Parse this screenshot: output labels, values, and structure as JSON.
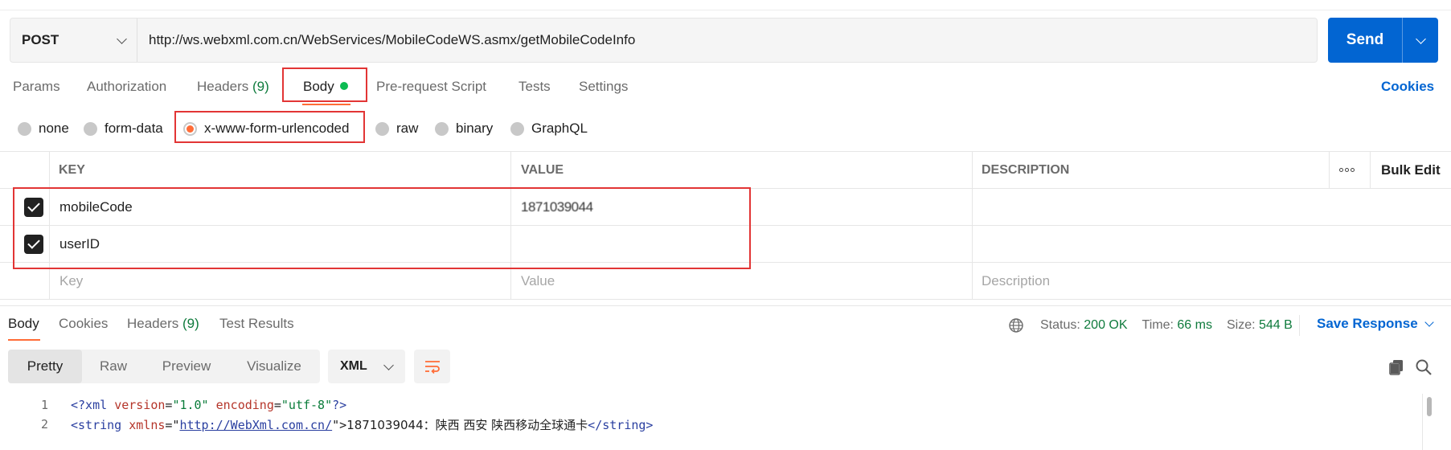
{
  "request": {
    "method": "POST",
    "url": "http://ws.webxml.com.cn/WebServices/MobileCodeWS.asmx/getMobileCodeInfo",
    "send_label": "Send"
  },
  "req_tabs": {
    "params": "Params",
    "authorization": "Authorization",
    "headers": "Headers",
    "headers_count": "(9)",
    "body": "Body",
    "pre_request": "Pre-request Script",
    "tests": "Tests",
    "settings": "Settings",
    "cookies": "Cookies"
  },
  "body_types": {
    "none": "none",
    "form_data": "form-data",
    "urlencoded": "x-www-form-urlencoded",
    "raw": "raw",
    "binary": "binary",
    "graphql": "GraphQL",
    "selected": "x-www-form-urlencoded"
  },
  "params_table": {
    "headers": {
      "key": "KEY",
      "value": "VALUE",
      "description": "DESCRIPTION",
      "bulk_edit": "Bulk Edit"
    },
    "rows": [
      {
        "key": "mobileCode",
        "value": "1871039044",
        "checked": true
      },
      {
        "key": "userID",
        "value": "",
        "checked": true
      }
    ],
    "placeholders": {
      "key": "Key",
      "value": "Value",
      "description": "Description"
    }
  },
  "response": {
    "tabs": {
      "body": "Body",
      "cookies": "Cookies",
      "headers": "Headers",
      "headers_count": "(9)",
      "test_results": "Test Results"
    },
    "status_label": "Status:",
    "status_value": "200 OK",
    "time_label": "Time:",
    "time_value": "66 ms",
    "size_label": "Size:",
    "size_value": "544 B",
    "save_label": "Save Response",
    "view_tabs": {
      "pretty": "Pretty",
      "raw": "Raw",
      "preview": "Preview",
      "visualize": "Visualize"
    },
    "format": "XML",
    "code_lines": {
      "l1_num": "1",
      "l2_num": "2",
      "l1_open": "<?xml ",
      "l1_attr1": "version",
      "l1_eq1": "=",
      "l1_val1": "\"1.0\"",
      "l1_attr2": " encoding",
      "l1_eq2": "=",
      "l1_val2": "\"utf-8\"",
      "l1_close": "?>",
      "l2_open": "<string ",
      "l2_attr": "xmlns",
      "l2_eq": "=\"",
      "l2_link": "http://WebXml.com.cn/",
      "l2_q": "\">",
      "l2_text": "1871039044：陕西 西安 陕西移动全球通卡",
      "l2_close": "</string>"
    }
  },
  "colors": {
    "accent": "#ff6c37",
    "primary": "#0265d2",
    "ok": "#0f7b3d",
    "annotation": "#e23535"
  }
}
